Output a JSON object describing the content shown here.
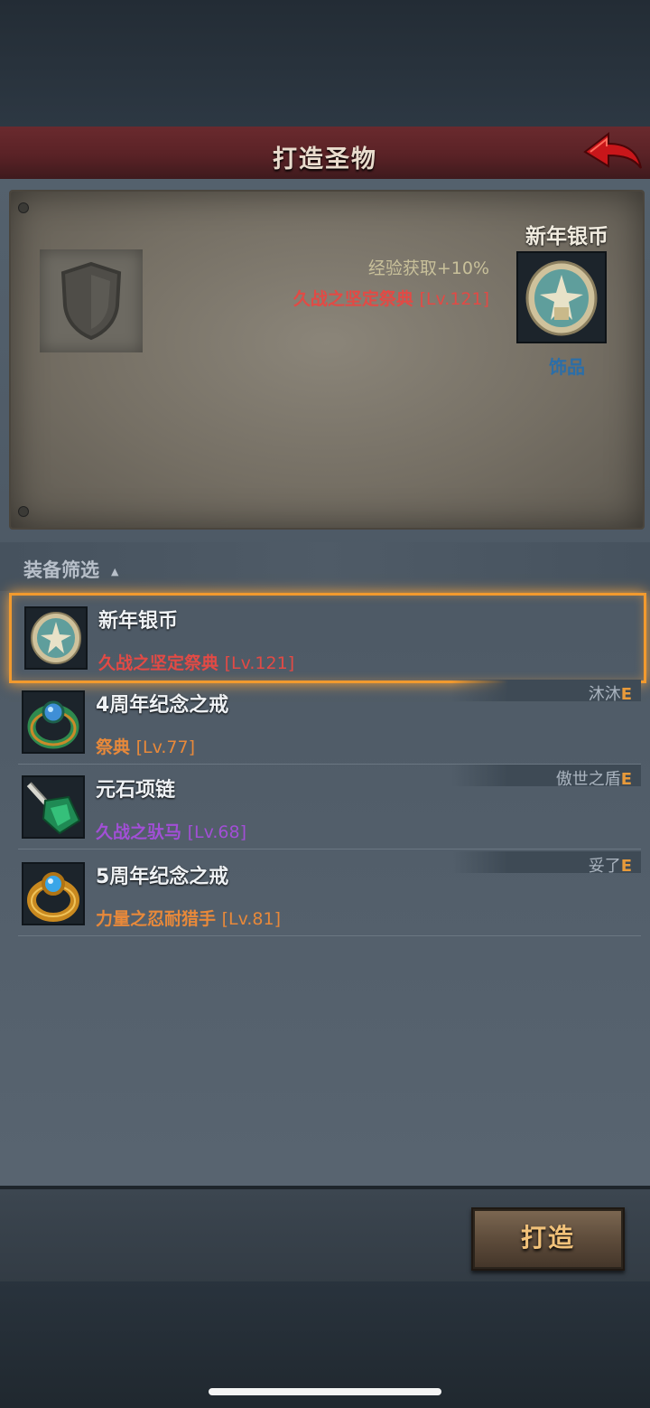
{
  "header": {
    "title": "打造圣物",
    "back_icon": "back-arrow-icon"
  },
  "preview": {
    "stat_exp": "经验获取+10%",
    "stat_set_name": "久战之坚定祭典 ",
    "stat_set_level": "[Lv.121]",
    "item_name": "新年银币",
    "item_type": "饰品",
    "item_icon": "silver-coin-icon"
  },
  "filter": {
    "label": "装备筛选",
    "arrow": "▲"
  },
  "list": {
    "items": [
      {
        "name": "新年银币",
        "set_name": "久战之坚定祭典 ",
        "set_level": "[Lv.121]",
        "set_color": "#e24a45",
        "owner": "",
        "equipped": "",
        "icon": "silver-coin-icon"
      },
      {
        "name": "4周年纪念之戒",
        "set_name": "祭典 ",
        "set_level": "[Lv.77]",
        "set_color": "#e8893a",
        "owner": "沐沐",
        "equipped": "E",
        "icon": "green-ring-icon"
      },
      {
        "name": "元石项链",
        "set_name": "久战之驮马 ",
        "set_level": "[Lv.68]",
        "set_color": "#a24fd6",
        "owner": "傲世之盾",
        "equipped": "E",
        "icon": "green-gem-necklace-icon"
      },
      {
        "name": "5周年纪念之戒",
        "set_name": "力量之忍耐猎手 ",
        "set_level": "[Lv.81]",
        "set_color": "#e8893a",
        "owner": "妥了",
        "equipped": "E",
        "icon": "gold-ring-icon"
      }
    ]
  },
  "actions": {
    "forge_label": "打造"
  }
}
